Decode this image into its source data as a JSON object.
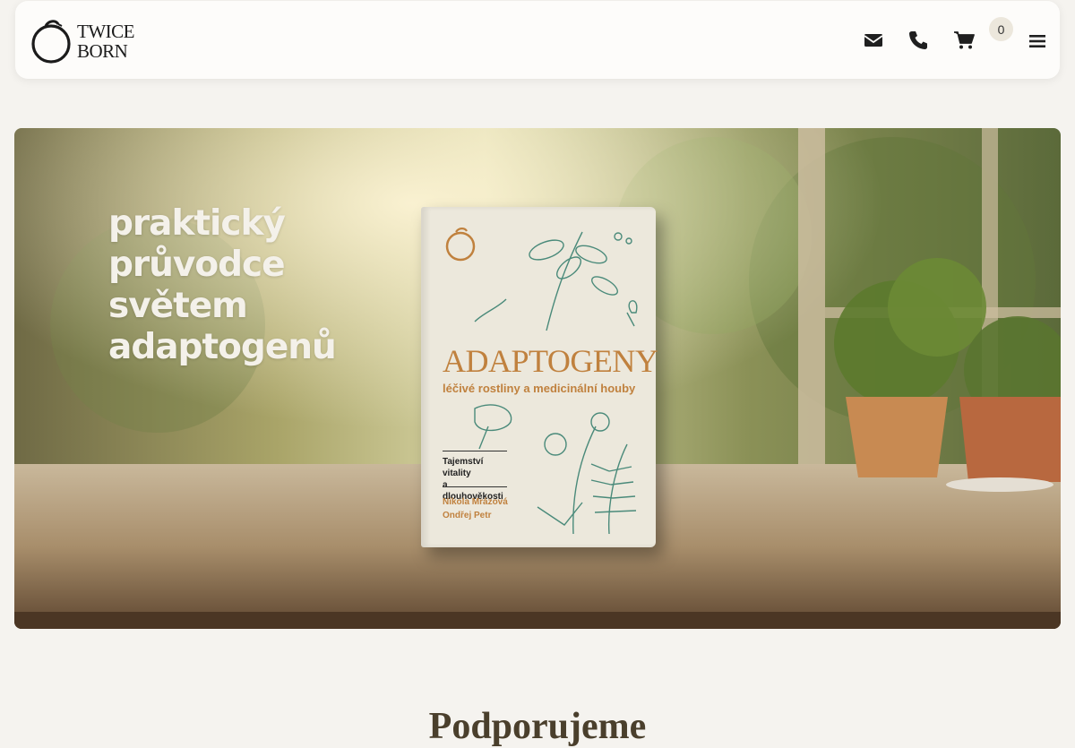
{
  "brand": {
    "line1": "TWICE",
    "line2": "BORN"
  },
  "header": {
    "icons": {
      "mail": "envelope-icon",
      "phone": "phone-icon",
      "cart": "cart-icon",
      "menu": "hamburger-icon"
    },
    "cart_count": "0"
  },
  "hero": {
    "lines": [
      "praktický",
      "průvodce",
      "světem",
      "adaptogenů"
    ],
    "book": {
      "title": "ADAPTOGENY",
      "subtitle": "léčivé rostliny a medicinální houby",
      "tagline": [
        "Tajemství vitality",
        "a dlouhověkosti"
      ],
      "authors": [
        "Nikola Mrázová",
        "Ondřej Petr"
      ]
    }
  },
  "section": {
    "title": "Podporujeme"
  },
  "colors": {
    "accent": "#c0813e",
    "heading": "#4a3f2c",
    "background": "#f5f3ef"
  }
}
